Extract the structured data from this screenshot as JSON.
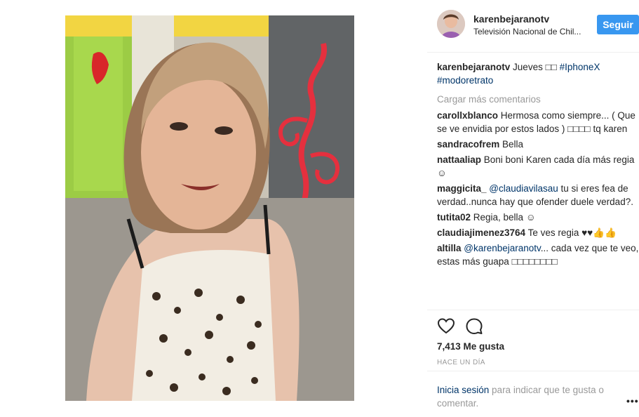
{
  "header": {
    "username": "karenbejaranotv",
    "location": "Televisión Nacional de Chil...",
    "follow_label": "Seguir"
  },
  "caption": {
    "username": "karenbejaranotv",
    "text": " Jueves □□ ",
    "hashtag1": "#IphoneX",
    "hashtag2": "#modoretrato"
  },
  "load_more": "Cargar más comentarios",
  "comments": [
    {
      "username": "carollxblanco",
      "text": " Hermosa como siempre... ( Que se ve envidia por estos lados ) □□□□ tq karen"
    },
    {
      "username": "sandracofrem",
      "text": " Bella"
    },
    {
      "username": "nattaaliap",
      "text": " Boni boni Karen cada día más regia ☺"
    },
    {
      "username": "maggicita_",
      "mention": " @claudiavilasau",
      "text": " tu si eres fea de verdad..nunca hay que ofender duele verdad?."
    },
    {
      "username": "tutita02",
      "text": " Regia, bella ☺"
    },
    {
      "username": "claudiajimenez3764",
      "text": " Te ves regia ♥♥👍👍"
    },
    {
      "username": "altilla",
      "mention": " @karenbejaranotv",
      "text": "... cada vez que te veo, estas más guapa □□□□□□□□"
    }
  ],
  "actions": {
    "like_icon": "heart-icon",
    "comment_icon": "comment-icon"
  },
  "likes": "7,413 Me gusta",
  "time": "HACE UN DÍA",
  "login": {
    "link": "Inicia sesión",
    "text": " para indicar que te gusta o comentar."
  },
  "more_label": "•••",
  "colors": {
    "accent": "#3897f0",
    "link": "#003569",
    "muted": "#999999"
  }
}
